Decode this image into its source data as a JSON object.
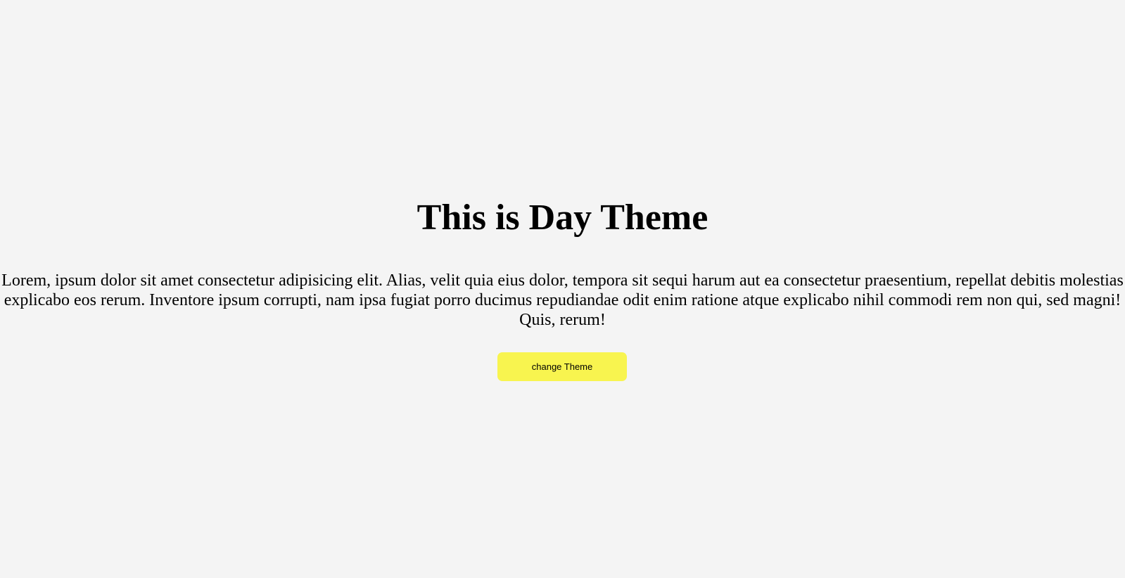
{
  "main": {
    "heading": "This is Day Theme",
    "paragraph": "Lorem, ipsum dolor sit amet consectetur adipisicing elit. Alias, velit quia eius dolor, tempora sit sequi harum aut ea consectetur praesentium, repellat debitis molestias explicabo eos rerum. Inventore ipsum corrupti, nam ipsa fugiat porro ducimus repudiandae odit enim ratione atque explicabo nihil commodi rem non qui, sed magni! Quis, rerum!",
    "button_label": "change Theme"
  },
  "colors": {
    "background": "#f4f4f4",
    "text": "#000000",
    "button_background": "#f8f44f"
  }
}
